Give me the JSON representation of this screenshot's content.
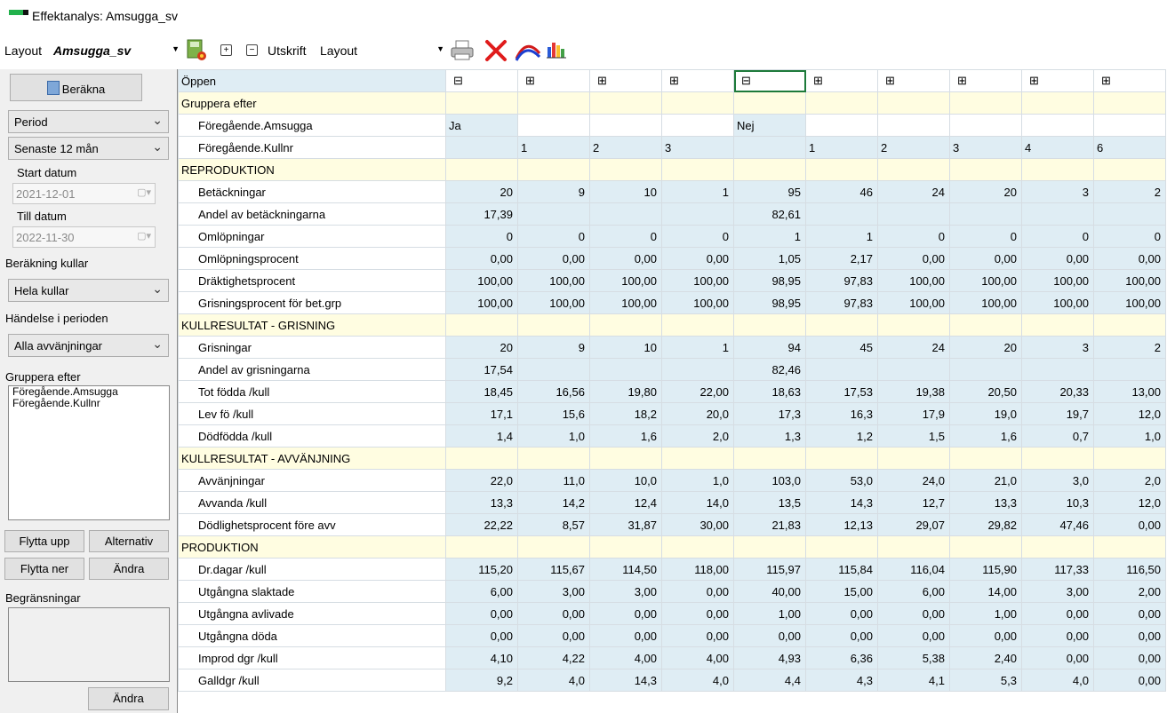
{
  "window": {
    "title": "Effektanalys: Amsugga_sv"
  },
  "toolbar": {
    "layout_label": "Layout",
    "layout_value": "Amsugga_sv",
    "expand_label": "+",
    "collapse_label": "−",
    "utskrift_label": "Utskrift",
    "utskrift_value": "Layout",
    "icons": [
      "save-layout-icon",
      "expand-icon",
      "collapse-icon",
      "print-icon",
      "delete-icon",
      "curve-chart-icon",
      "bar-chart-icon"
    ]
  },
  "left": {
    "calculate_label": "Beräkna",
    "period_value": "Period",
    "range_value": "Senaste 12 mån",
    "start_label": "Start datum",
    "start_value": "2021-12-01",
    "end_label": "Till datum",
    "end_value": "2022-11-30",
    "berakning_label": "Beräkning kullar",
    "berakning_value": "Hela kullar",
    "handelse_label": "Händelse i perioden",
    "handelse_value": "Alla avvänjningar",
    "group_label": "Gruppera efter",
    "group_items": [
      "Föregående.Amsugga",
      "Föregående.Kullnr"
    ],
    "move_up_label": "Flytta upp",
    "alternatives_label": "Alternativ",
    "move_down_label": "Flytta ner",
    "change_label": "Ändra",
    "restrictions_label": "Begränsningar",
    "change2_label": "Ändra"
  },
  "grid": {
    "open_label": "Öppen",
    "group_label": "Gruppera efter",
    "amsugga_label": "Föregående.Amsugga",
    "amsugga_values": [
      "Ja",
      "",
      "",
      "",
      "Nej",
      "",
      "",
      "",
      "",
      ""
    ],
    "kullnr_label": "Föregående.Kullnr",
    "kullnr_values": [
      "",
      "1",
      "2",
      "3",
      "",
      "1",
      "2",
      "3",
      "4",
      "6"
    ],
    "selected_column": 4,
    "rows": [
      {
        "type": "section",
        "label": "REPRODUKTION"
      },
      {
        "type": "data",
        "label": "Betäckningar",
        "values": [
          "20",
          "9",
          "10",
          "1",
          "95",
          "46",
          "24",
          "20",
          "3",
          "2"
        ]
      },
      {
        "type": "data",
        "label": "Andel av betäckningarna",
        "values": [
          "17,39",
          "",
          "",
          "",
          "82,61",
          "",
          "",
          "",
          "",
          ""
        ]
      },
      {
        "type": "data",
        "label": "Omlöpningar",
        "values": [
          "0",
          "0",
          "0",
          "0",
          "1",
          "1",
          "0",
          "0",
          "0",
          "0"
        ]
      },
      {
        "type": "data",
        "label": "Omlöpningsprocent",
        "values": [
          "0,00",
          "0,00",
          "0,00",
          "0,00",
          "1,05",
          "2,17",
          "0,00",
          "0,00",
          "0,00",
          "0,00"
        ]
      },
      {
        "type": "data",
        "label": "Dräktighetsprocent",
        "values": [
          "100,00",
          "100,00",
          "100,00",
          "100,00",
          "98,95",
          "97,83",
          "100,00",
          "100,00",
          "100,00",
          "100,00"
        ]
      },
      {
        "type": "data",
        "label": "Grisningsprocent för bet.grp",
        "values": [
          "100,00",
          "100,00",
          "100,00",
          "100,00",
          "98,95",
          "97,83",
          "100,00",
          "100,00",
          "100,00",
          "100,00"
        ]
      },
      {
        "type": "section",
        "label": "KULLRESULTAT - GRISNING"
      },
      {
        "type": "data",
        "label": "Grisningar",
        "values": [
          "20",
          "9",
          "10",
          "1",
          "94",
          "45",
          "24",
          "20",
          "3",
          "2"
        ]
      },
      {
        "type": "data",
        "label": "Andel av grisningarna",
        "values": [
          "17,54",
          "",
          "",
          "",
          "82,46",
          "",
          "",
          "",
          "",
          ""
        ]
      },
      {
        "type": "data",
        "label": "Tot födda /kull",
        "values": [
          "18,45",
          "16,56",
          "19,80",
          "22,00",
          "18,63",
          "17,53",
          "19,38",
          "20,50",
          "20,33",
          "13,00"
        ]
      },
      {
        "type": "data",
        "label": "Lev fö /kull",
        "values": [
          "17,1",
          "15,6",
          "18,2",
          "20,0",
          "17,3",
          "16,3",
          "17,9",
          "19,0",
          "19,7",
          "12,0"
        ]
      },
      {
        "type": "data",
        "label": "Dödfödda /kull",
        "values": [
          "1,4",
          "1,0",
          "1,6",
          "2,0",
          "1,3",
          "1,2",
          "1,5",
          "1,6",
          "0,7",
          "1,0"
        ]
      },
      {
        "type": "section",
        "label": "KULLRESULTAT - AVVÄNJNING"
      },
      {
        "type": "data",
        "label": "Avvänjningar",
        "values": [
          "22,0",
          "11,0",
          "10,0",
          "1,0",
          "103,0",
          "53,0",
          "24,0",
          "21,0",
          "3,0",
          "2,0"
        ]
      },
      {
        "type": "data",
        "label": "Avvanda /kull",
        "values": [
          "13,3",
          "14,2",
          "12,4",
          "14,0",
          "13,5",
          "14,3",
          "12,7",
          "13,3",
          "10,3",
          "12,0"
        ]
      },
      {
        "type": "data",
        "label": "Dödlighetsprocent före avv",
        "values": [
          "22,22",
          "8,57",
          "31,87",
          "30,00",
          "21,83",
          "12,13",
          "29,07",
          "29,82",
          "47,46",
          "0,00"
        ]
      },
      {
        "type": "section",
        "label": "PRODUKTION"
      },
      {
        "type": "data",
        "label": "Dr.dagar /kull",
        "values": [
          "115,20",
          "115,67",
          "114,50",
          "118,00",
          "115,97",
          "115,84",
          "116,04",
          "115,90",
          "117,33",
          "116,50"
        ]
      },
      {
        "type": "data",
        "label": "Utgångna slaktade",
        "values": [
          "6,00",
          "3,00",
          "3,00",
          "0,00",
          "40,00",
          "15,00",
          "6,00",
          "14,00",
          "3,00",
          "2,00"
        ]
      },
      {
        "type": "data",
        "label": "Utgångna avlivade",
        "values": [
          "0,00",
          "0,00",
          "0,00",
          "0,00",
          "1,00",
          "0,00",
          "0,00",
          "1,00",
          "0,00",
          "0,00"
        ]
      },
      {
        "type": "data",
        "label": "Utgångna döda",
        "values": [
          "0,00",
          "0,00",
          "0,00",
          "0,00",
          "0,00",
          "0,00",
          "0,00",
          "0,00",
          "0,00",
          "0,00"
        ]
      },
      {
        "type": "data",
        "label": "Improd dgr /kull",
        "values": [
          "4,10",
          "4,22",
          "4,00",
          "4,00",
          "4,93",
          "6,36",
          "5,38",
          "2,40",
          "0,00",
          "0,00"
        ]
      },
      {
        "type": "data",
        "label": "Galldgr /kull",
        "values": [
          "9,2",
          "4,0",
          "14,3",
          "4,0",
          "4,4",
          "4,3",
          "4,1",
          "5,3",
          "4,0",
          "0,00"
        ]
      }
    ]
  }
}
